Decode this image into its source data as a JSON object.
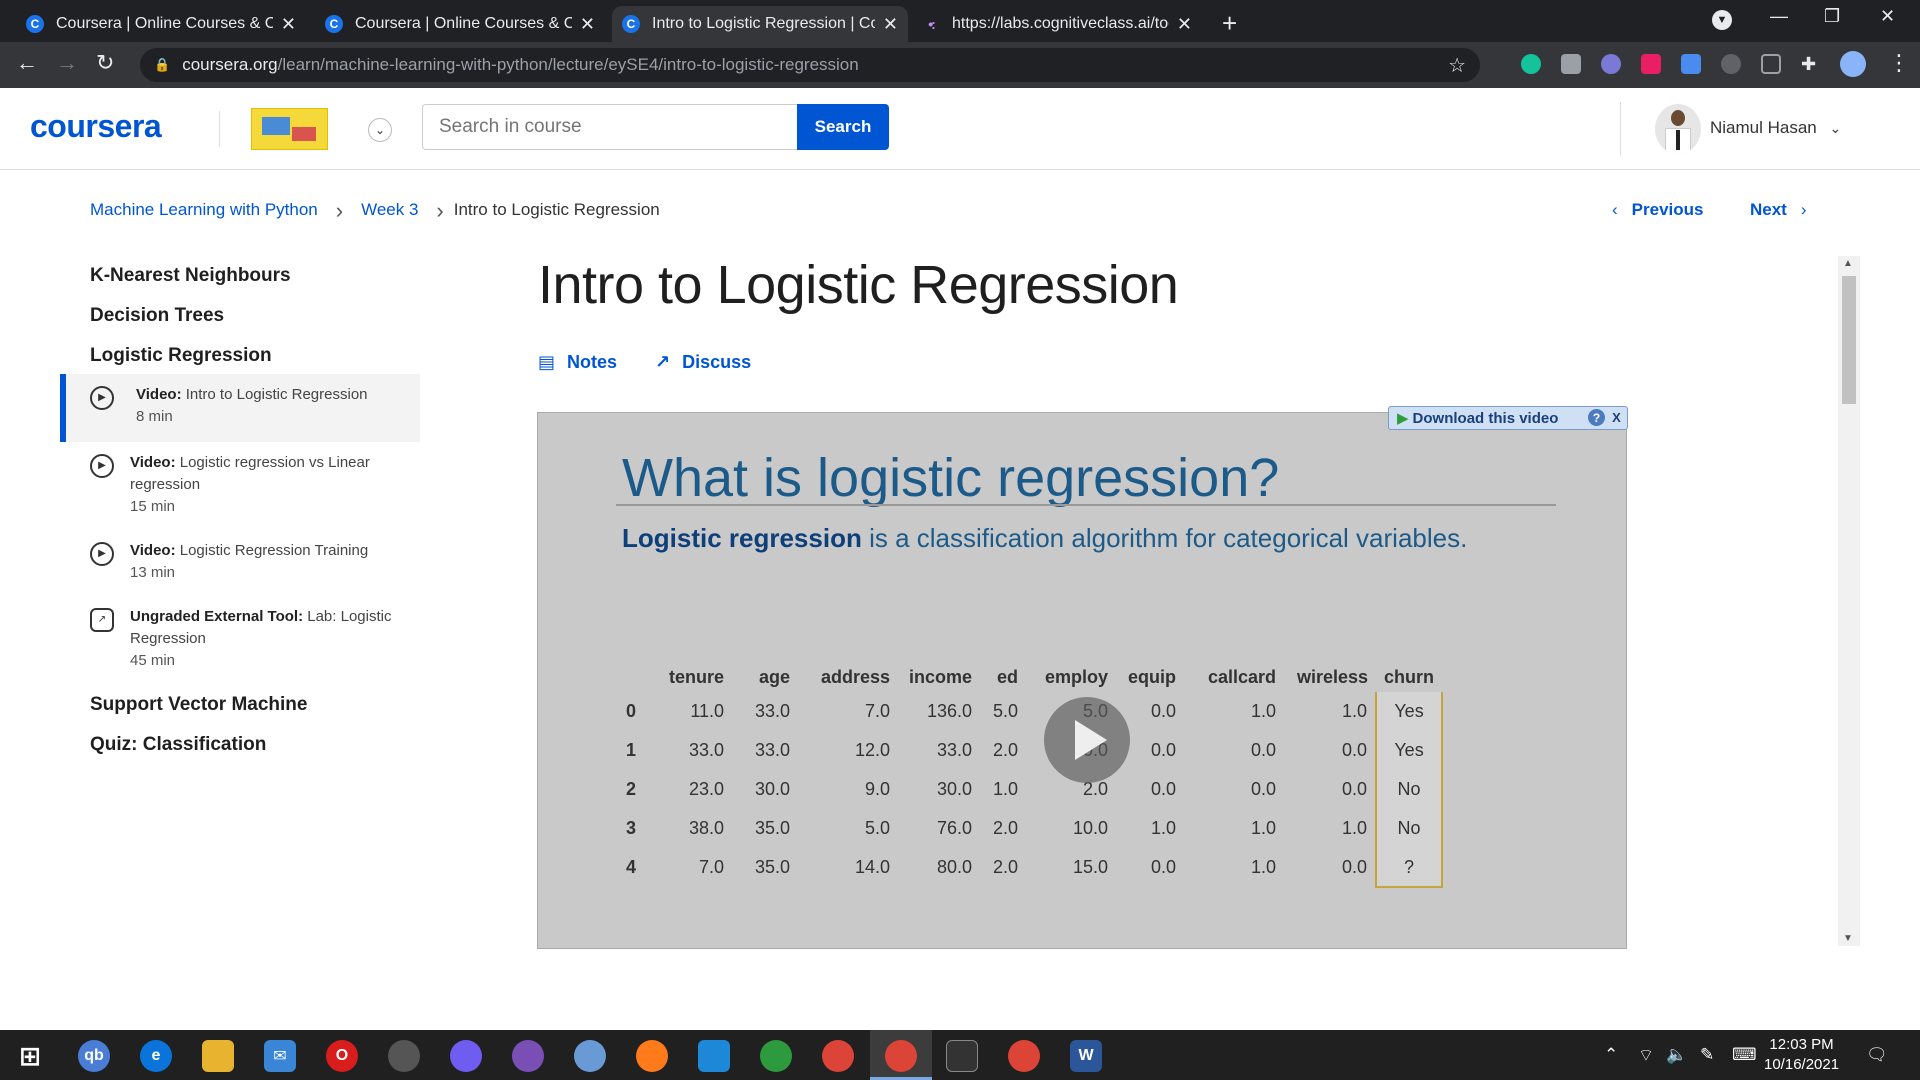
{
  "browser": {
    "tabs": [
      {
        "title": "Coursera | Online Courses & Cred",
        "favicon": "C"
      },
      {
        "title": "Coursera | Online Courses & Cred",
        "favicon": "C"
      },
      {
        "title": "Intro to Logistic Regression | Cou",
        "favicon": "C"
      },
      {
        "title": "https://labs.cognitiveclass.ai/tool",
        "favicon": "•:"
      }
    ],
    "url_host": "coursera.org",
    "url_path": "/learn/machine-learning-with-python/lecture/eySE4/intro-to-logistic-regression"
  },
  "header": {
    "logo": "coursera",
    "search_placeholder": "Search in course",
    "search_button": "Search",
    "user_name": "Niamul Hasan"
  },
  "breadcrumb": {
    "items": [
      "Machine Learning with Python",
      "Week 3"
    ],
    "current": "Intro to Logistic Regression"
  },
  "pager": {
    "previous": "Previous",
    "next": "Next"
  },
  "sidebar": {
    "sections": [
      "K-Nearest Neighbours",
      "Decision Trees",
      "Logistic Regression",
      "Support Vector Machine",
      "Quiz: Classification"
    ],
    "items": [
      {
        "type": "Video:",
        "title": "Intro to Logistic Regression",
        "duration": "8 min",
        "icon": "play-icon"
      },
      {
        "type": "Video:",
        "title": "Logistic regression vs Linear regression",
        "duration": "15 min",
        "icon": "play-icon"
      },
      {
        "type": "Video:",
        "title": "Logistic Regression Training",
        "duration": "13 min",
        "icon": "play-icon"
      },
      {
        "type": "Ungraded External Tool:",
        "title": "Lab: Logistic Regression",
        "duration": "45 min",
        "icon": "external-link-icon"
      }
    ]
  },
  "main": {
    "title": "Intro to Logistic Regression",
    "notes_label": "Notes",
    "discuss_label": "Discuss"
  },
  "video": {
    "download_label": "Download this video",
    "slide_title": "What is logistic regression?",
    "slide_subtitle_bold": "Logistic regression",
    "slide_subtitle_rest": " is a classification algorithm for categorical variables.",
    "table": {
      "columns": [
        "",
        "tenure",
        "age",
        "address",
        "income",
        "ed",
        "employ",
        "equip",
        "callcard",
        "wireless",
        "churn"
      ],
      "rows": [
        [
          "0",
          "11.0",
          "33.0",
          "7.0",
          "136.0",
          "5.0",
          "5.0",
          "0.0",
          "1.0",
          "1.0",
          "Yes"
        ],
        [
          "1",
          "33.0",
          "33.0",
          "12.0",
          "33.0",
          "2.0",
          "0.0",
          "0.0",
          "0.0",
          "0.0",
          "Yes"
        ],
        [
          "2",
          "23.0",
          "30.0",
          "9.0",
          "30.0",
          "1.0",
          "2.0",
          "0.0",
          "0.0",
          "0.0",
          "No"
        ],
        [
          "3",
          "38.0",
          "35.0",
          "5.0",
          "76.0",
          "2.0",
          "10.0",
          "1.0",
          "1.0",
          "1.0",
          "No"
        ],
        [
          "4",
          "7.0",
          "35.0",
          "14.0",
          "80.0",
          "2.0",
          "15.0",
          "0.0",
          "1.0",
          "0.0",
          "?"
        ]
      ]
    }
  },
  "taskbar": {
    "time": "12:03 PM",
    "date": "10/16/2021"
  },
  "colors": {
    "brand": "#0056d2",
    "tabbar": "#202124",
    "toolbar": "#35363a"
  }
}
